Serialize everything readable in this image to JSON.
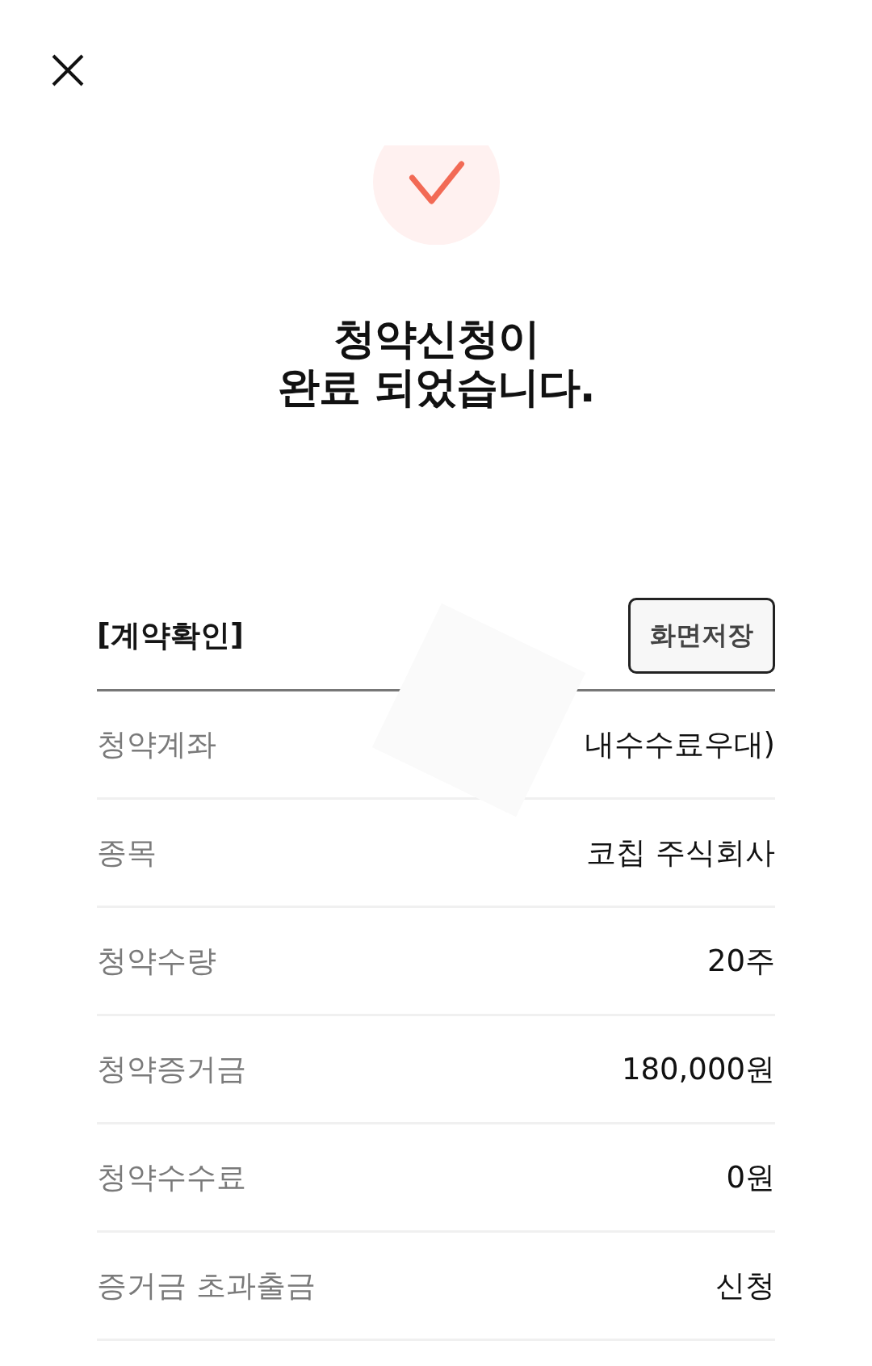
{
  "title": [
    "청약신청이",
    "완료 되었습니다."
  ],
  "section": {
    "title": "[계약확인]",
    "save_button": "화면저장"
  },
  "rows": [
    {
      "label": "청약계좌",
      "value": "내수수료우대)"
    },
    {
      "label": "종목",
      "value": "코칩 주식회사"
    },
    {
      "label": "청약수량",
      "value": "20주"
    },
    {
      "label": "청약증거금",
      "value": "180,000원"
    },
    {
      "label": "청약수수료",
      "value": "0원"
    },
    {
      "label": "증거금 초과출금",
      "value": "신청"
    }
  ]
}
